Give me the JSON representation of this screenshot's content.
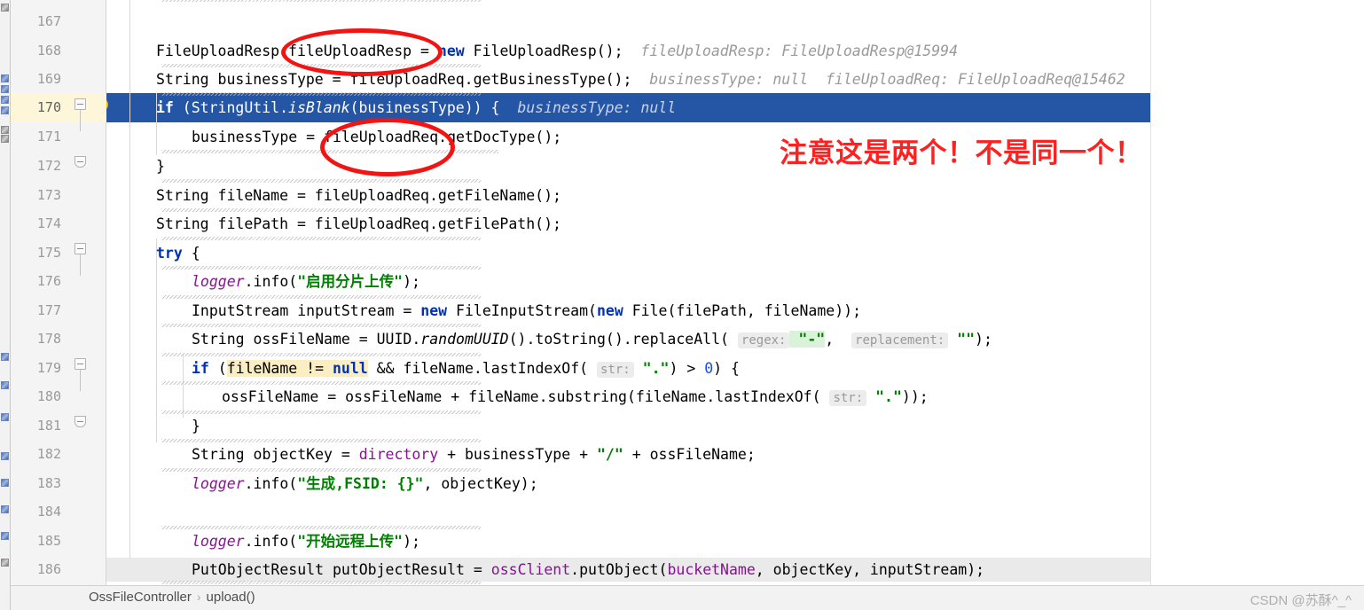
{
  "app": {
    "kind": "intellij-idea-code-editor",
    "language": "Java"
  },
  "gutter": {
    "line_numbers": [
      "167",
      "168",
      "169",
      "170",
      "171",
      "172",
      "173",
      "174",
      "175",
      "176",
      "177",
      "178",
      "179",
      "180",
      "181",
      "182",
      "183",
      "184",
      "185",
      "186"
    ],
    "highlighted_line": "170",
    "bulb_icon": "lightbulb-icon"
  },
  "editor": {
    "selected_line_number": "170",
    "lines": [
      {
        "n": "167",
        "text": ""
      },
      {
        "n": "168",
        "text": "FileUploadResp fileUploadResp = new FileUploadResp();   fileUploadResp: FileUploadResp@15994"
      },
      {
        "n": "169",
        "text": "String businessType = fileUploadReq.getBusinessType();   businessType: null   fileUploadReq: FileUploadReq@15462"
      },
      {
        "n": "170",
        "text": "if (StringUtil.isBlank(businessType)) {   businessType: null"
      },
      {
        "n": "171",
        "text": "businessType = fileUploadReq.getDocType();"
      },
      {
        "n": "172",
        "text": "}"
      },
      {
        "n": "173",
        "text": "String fileName = fileUploadReq.getFileName();"
      },
      {
        "n": "174",
        "text": "String filePath = fileUploadReq.getFilePath();"
      },
      {
        "n": "175",
        "text": "try {"
      },
      {
        "n": "176",
        "text": "logger.info(\"启用分片上传\");"
      },
      {
        "n": "177",
        "text": "InputStream inputStream = new FileInputStream(new File(filePath, fileName));"
      },
      {
        "n": "178",
        "text": "String ossFileName = UUID.randomUUID().toString().replaceAll( regex: \"-\",  replacement: \"\");"
      },
      {
        "n": "179",
        "text": "if (fileName != null && fileName.lastIndexOf( str: \".\") > 0) {"
      },
      {
        "n": "180",
        "text": "ossFileName = ossFileName + fileName.substring(fileName.lastIndexOf( str: \".\"));"
      },
      {
        "n": "181",
        "text": "}"
      },
      {
        "n": "182",
        "text": "String objectKey = directory + businessType + \"/\" + ossFileName;"
      },
      {
        "n": "183",
        "text": "logger.info(\"生成,FSID: {}\", objectKey);"
      },
      {
        "n": "184",
        "text": ""
      },
      {
        "n": "185",
        "text": "logger.info(\"开始远程上传\");"
      },
      {
        "n": "186",
        "text": "PutObjectResult putObjectResult = ossClient.putObject(bucketName, objectKey, inputStream);"
      }
    ],
    "inlay_hints": {
      "regex": "regex:",
      "replacement": "replacement:",
      "str": "str:"
    },
    "debug_values": {
      "line168": "fileUploadResp: FileUploadResp@15994",
      "line169_a": "businessType: null",
      "line169_b": "fileUploadReq: FileUploadReq@15462",
      "line170": "businessType: null"
    }
  },
  "annotations": {
    "note_text": "注意这是两个！不是同一个！",
    "note_color": "#ff2020",
    "oval_color": "#f21313",
    "oval_targets": [
      "fileUploadResp",
      "fileUploadReq"
    ]
  },
  "breadcrumb": {
    "class": "OssFileController",
    "separator": "›",
    "method": "upload()"
  },
  "watermark": {
    "text": "CSDN @苏酥^_^"
  },
  "colors": {
    "selection_blue": "#2555a5",
    "keyword_blue": "#0033b3",
    "string_green": "#008000",
    "field_purple": "#871094",
    "number_blue": "#1750eb",
    "gutter_bg": "#f4f4f4",
    "gutter_highlight": "#fdf6d8",
    "inlay_grey": "#ececec"
  }
}
